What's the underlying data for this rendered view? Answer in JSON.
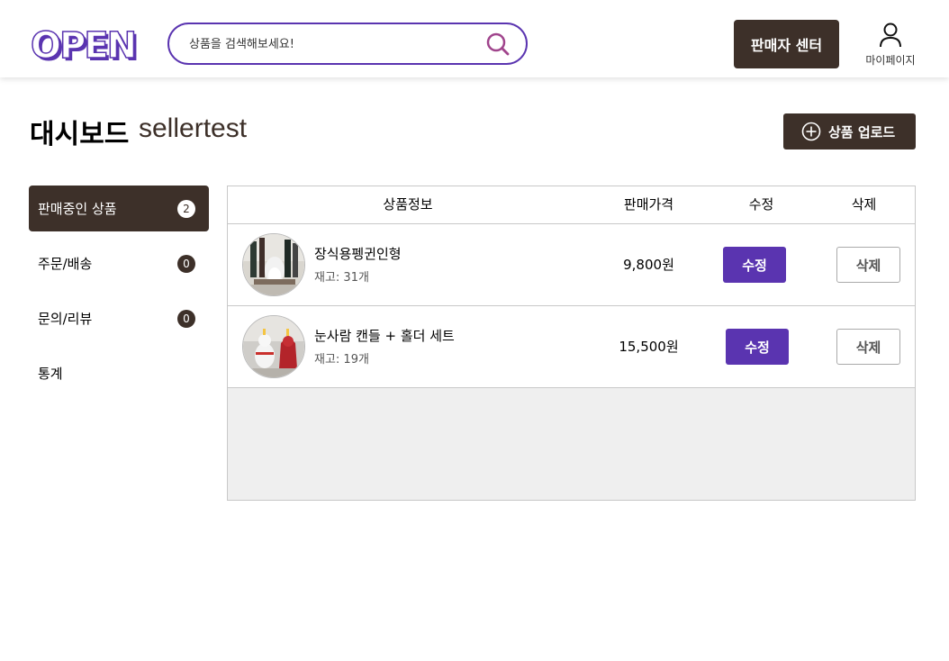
{
  "header": {
    "logo_text": "OPEN",
    "search_placeholder": "상품을 검색해보세요!",
    "seller_center_label": "판매자 센터",
    "mypage_label": "마이페이지"
  },
  "dashboard": {
    "title": "대시보드",
    "seller_name": "sellertest",
    "upload_label": "상품 업로드"
  },
  "sidebar": {
    "items": [
      {
        "label": "판매중인 상품",
        "count": "2",
        "active": true
      },
      {
        "label": "주문/배송",
        "count": "0",
        "active": false
      },
      {
        "label": "문의/리뷰",
        "count": "0",
        "active": false
      },
      {
        "label": "통계",
        "count": "",
        "active": false
      }
    ]
  },
  "table": {
    "headers": [
      "상품정보",
      "판매가격",
      "수정",
      "삭제"
    ],
    "rows": [
      {
        "name": "장식용펭귄인형",
        "stock": "재고: 31개",
        "price": "9,800원",
        "edit_label": "수정",
        "delete_label": "삭제"
      },
      {
        "name": "눈사람 캔들 + 홀더 세트",
        "stock": "재고: 19개",
        "price": "15,500원",
        "edit_label": "수정",
        "delete_label": "삭제"
      }
    ]
  },
  "colors": {
    "brand_purple": "#5a34b0",
    "dark_brown": "#3d3029"
  },
  "icons": {
    "search": "search-icon",
    "user": "user-icon",
    "plus_circle": "plus-circle-icon"
  }
}
